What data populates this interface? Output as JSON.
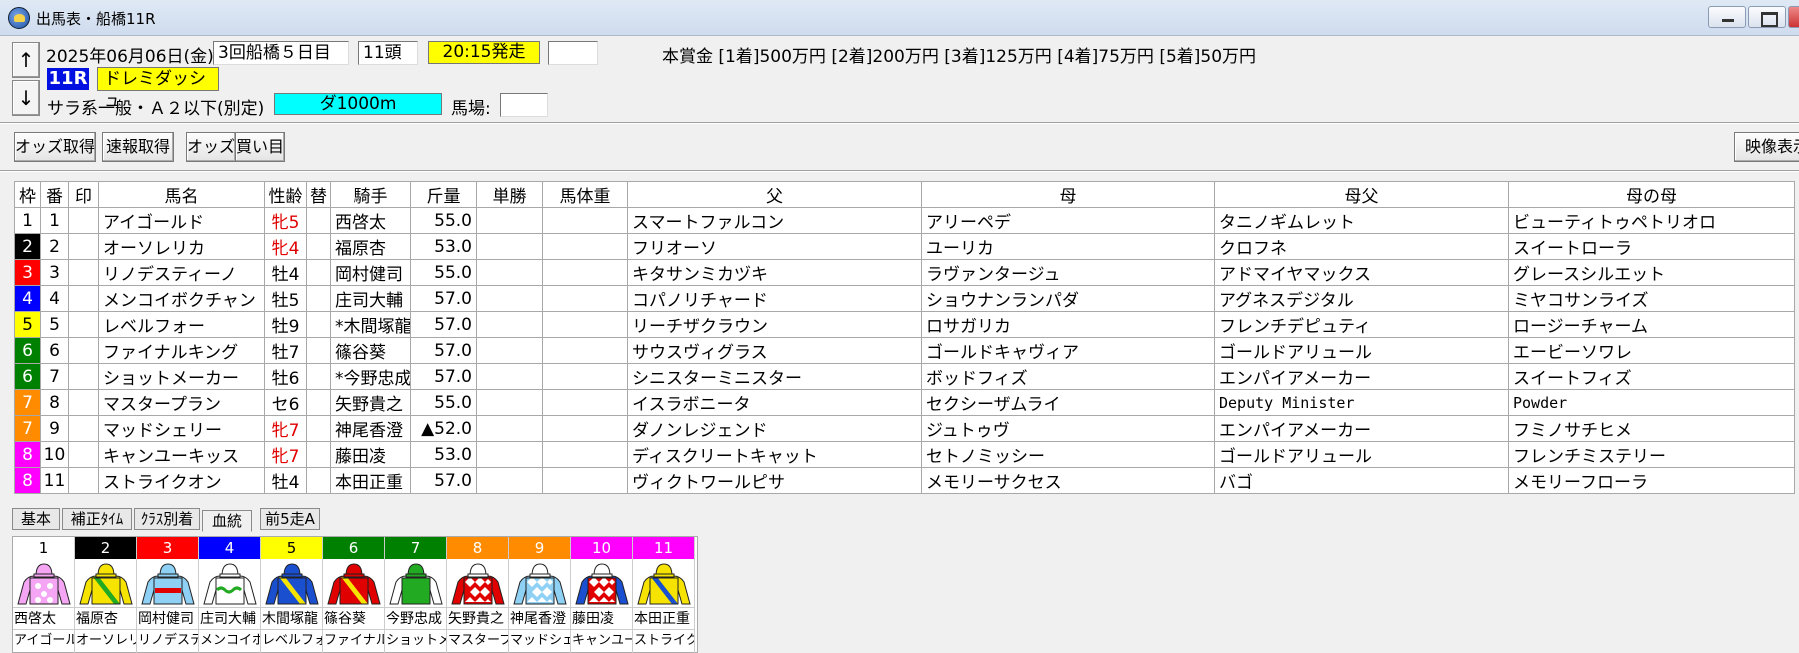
{
  "window": {
    "title": "出馬表・船橋11R"
  },
  "header": {
    "date": "2025年06月06日(金)",
    "meeting": "3回船橋５日目",
    "runners": "11頭",
    "post_time": "20:15発走",
    "race_no": "11R",
    "race_name": "ドレミダッシュ",
    "condition": "サラ系一般・Ａ２以下(別定)",
    "distance": "ダ1000m",
    "track_label": "馬場:",
    "prize": "本賞金 [1着]500万円 [2着]200万円 [3着]125万円 [4着]75万円 [5着]50万円"
  },
  "toolbar": {
    "odds_fetch": "オッズ取得",
    "flash_fetch": "速報取得",
    "odds": "オッズ",
    "bets": "買い目",
    "video": "映像表示"
  },
  "table": {
    "headers": [
      "枠",
      "番",
      "印",
      "馬名",
      "性齢",
      "替",
      "騎手",
      "斤量",
      "単勝",
      "馬体重",
      "父",
      "母",
      "母父",
      "母の母"
    ],
    "rows": [
      {
        "waku": "1",
        "num": "1",
        "horse": "アイゴールド",
        "sexage": "牝5",
        "jockey": "西啓太",
        "weight": "55.0",
        "sire": "スマートファルコン",
        "dam": "アリーペデ",
        "damsire": "タニノギムレット",
        "damdam": "ビューティトゥペトリオロ"
      },
      {
        "waku": "2",
        "num": "2",
        "horse": "オーソレリカ",
        "sexage": "牝4",
        "jockey": "福原杏",
        "weight": "53.0",
        "sire": "フリオーソ",
        "dam": "ユーリカ",
        "damsire": "クロフネ",
        "damdam": "スイートローラ"
      },
      {
        "waku": "3",
        "num": "3",
        "horse": "リノデスティーノ",
        "sexage": "牡4",
        "jockey": "岡村健司",
        "weight": "55.0",
        "sire": "キタサンミカヅキ",
        "dam": "ラヴァンタージュ",
        "damsire": "アドマイヤマックス",
        "damdam": "グレースシルエット"
      },
      {
        "waku": "4",
        "num": "4",
        "horse": "メンコイボクチャン",
        "sexage": "牡5",
        "jockey": "庄司大輔",
        "weight": "57.0",
        "sire": "コパノリチャード",
        "dam": "ショウナンランパダ",
        "damsire": "アグネスデジタル",
        "damdam": "ミヤコサンライズ"
      },
      {
        "waku": "5",
        "num": "5",
        "horse": "レベルフォー",
        "sexage": "牡9",
        "jockey": "*木間塚龍",
        "weight": "57.0",
        "sire": "リーチザクラウン",
        "dam": "ロサガリカ",
        "damsire": "フレンチデピュティ",
        "damdam": "ロージーチャーム"
      },
      {
        "waku": "6",
        "num": "6",
        "horse": "ファイナルキング",
        "sexage": "牡7",
        "jockey": "篠谷葵",
        "weight": "57.0",
        "sire": "サウスヴィグラス",
        "dam": "ゴールドキャヴィア",
        "damsire": "ゴールドアリュール",
        "damdam": "エービーソワレ"
      },
      {
        "waku": "6",
        "num": "7",
        "horse": "ショットメーカー",
        "sexage": "牡6",
        "jockey": "*今野忠成",
        "weight": "57.0",
        "sire": "シニスターミニスター",
        "dam": "ボッドフィズ",
        "damsire": "エンパイアメーカー",
        "damdam": "スイートフィズ"
      },
      {
        "waku": "7",
        "num": "8",
        "horse": "マスタープラン",
        "sexage": "セ6",
        "jockey": "矢野貴之",
        "weight": "55.0",
        "sire": "イスラボニータ",
        "dam": "セクシーザムライ",
        "damsire": "Deputy Minister",
        "damdam": "Powder"
      },
      {
        "waku": "7",
        "num": "9",
        "horse": "マッドシェリー",
        "sexage": "牝7",
        "jockey": "神尾香澄",
        "weight": "▲52.0",
        "sire": "ダノンレジェンド",
        "dam": "ジュトゥヴ",
        "damsire": "エンパイアメーカー",
        "damdam": "フミノサチヒメ"
      },
      {
        "waku": "8",
        "num": "10",
        "horse": "キャンユーキッス",
        "sexage": "牝7",
        "jockey": "藤田凌",
        "weight": "53.0",
        "sire": "ディスクリートキャット",
        "dam": "セトノミッシー",
        "damsire": "ゴールドアリュール",
        "damdam": "フレンチミステリー"
      },
      {
        "waku": "8",
        "num": "11",
        "horse": "ストライクオン",
        "sexage": "牡4",
        "jockey": "本田正重",
        "weight": "57.0",
        "sire": "ヴィクトワールピサ",
        "dam": "メモリーサクセス",
        "damsire": "バゴ",
        "damdam": "メモリーフローラ"
      }
    ]
  },
  "tabs": [
    "基本",
    "補正ﾀｲﾑ",
    "ｸﾗｽ別着",
    "血統",
    "前5走A"
  ],
  "silks": {
    "jockeys": [
      "西啓太",
      "福原杏",
      "岡村健司",
      "庄司大輔",
      "木間塚龍",
      "篠谷葵",
      "今野忠成",
      "矢野貴之",
      "神尾香澄",
      "藤田凌",
      "本田正重"
    ],
    "horses": [
      "アイゴール",
      "オーソレリ",
      "リノデスティ",
      "メンコイボ",
      "レベルフォ",
      "ファイナル",
      "ショットメ",
      "マスタープ",
      "マッドシェ",
      "キャンユー",
      "ストライク"
    ]
  },
  "colors": {
    "waku": {
      "1": "#ffffff",
      "2": "#000000",
      "3": "#ff0000",
      "4": "#0000ff",
      "5": "#ffff00",
      "6": "#008000",
      "7": "#ff8c00",
      "8": "#ff00ff"
    },
    "waku_text": {
      "1": "#000000",
      "2": "#ffffff",
      "3": "#ffffff",
      "4": "#ffffff",
      "5": "#000000",
      "6": "#ffffff",
      "7": "#ffffff",
      "8": "#ffffff"
    },
    "post_time": "#ffff00",
    "distance": "#00ffff",
    "race_no": "#0010e0",
    "filly_text": "#e00000"
  }
}
